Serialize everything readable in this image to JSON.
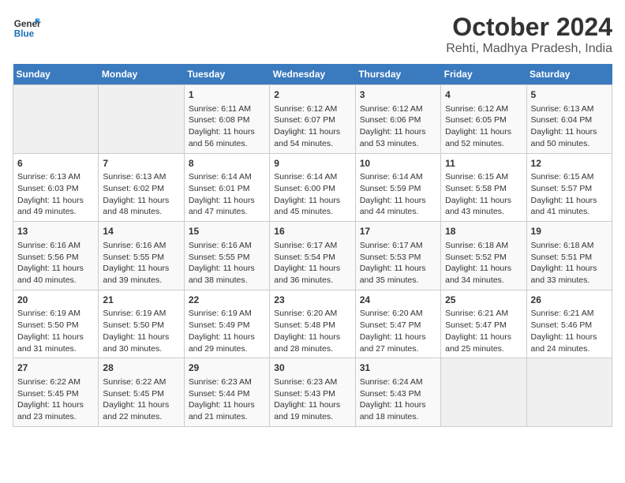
{
  "header": {
    "logo_line1": "General",
    "logo_line2": "Blue",
    "title": "October 2024",
    "subtitle": "Rehti, Madhya Pradesh, India"
  },
  "days_of_week": [
    "Sunday",
    "Monday",
    "Tuesday",
    "Wednesday",
    "Thursday",
    "Friday",
    "Saturday"
  ],
  "weeks": [
    [
      {
        "day": "",
        "content": ""
      },
      {
        "day": "",
        "content": ""
      },
      {
        "day": "1",
        "content": "Sunrise: 6:11 AM\nSunset: 6:08 PM\nDaylight: 11 hours and 56 minutes."
      },
      {
        "day": "2",
        "content": "Sunrise: 6:12 AM\nSunset: 6:07 PM\nDaylight: 11 hours and 54 minutes."
      },
      {
        "day": "3",
        "content": "Sunrise: 6:12 AM\nSunset: 6:06 PM\nDaylight: 11 hours and 53 minutes."
      },
      {
        "day": "4",
        "content": "Sunrise: 6:12 AM\nSunset: 6:05 PM\nDaylight: 11 hours and 52 minutes."
      },
      {
        "day": "5",
        "content": "Sunrise: 6:13 AM\nSunset: 6:04 PM\nDaylight: 11 hours and 50 minutes."
      }
    ],
    [
      {
        "day": "6",
        "content": "Sunrise: 6:13 AM\nSunset: 6:03 PM\nDaylight: 11 hours and 49 minutes."
      },
      {
        "day": "7",
        "content": "Sunrise: 6:13 AM\nSunset: 6:02 PM\nDaylight: 11 hours and 48 minutes."
      },
      {
        "day": "8",
        "content": "Sunrise: 6:14 AM\nSunset: 6:01 PM\nDaylight: 11 hours and 47 minutes."
      },
      {
        "day": "9",
        "content": "Sunrise: 6:14 AM\nSunset: 6:00 PM\nDaylight: 11 hours and 45 minutes."
      },
      {
        "day": "10",
        "content": "Sunrise: 6:14 AM\nSunset: 5:59 PM\nDaylight: 11 hours and 44 minutes."
      },
      {
        "day": "11",
        "content": "Sunrise: 6:15 AM\nSunset: 5:58 PM\nDaylight: 11 hours and 43 minutes."
      },
      {
        "day": "12",
        "content": "Sunrise: 6:15 AM\nSunset: 5:57 PM\nDaylight: 11 hours and 41 minutes."
      }
    ],
    [
      {
        "day": "13",
        "content": "Sunrise: 6:16 AM\nSunset: 5:56 PM\nDaylight: 11 hours and 40 minutes."
      },
      {
        "day": "14",
        "content": "Sunrise: 6:16 AM\nSunset: 5:55 PM\nDaylight: 11 hours and 39 minutes."
      },
      {
        "day": "15",
        "content": "Sunrise: 6:16 AM\nSunset: 5:55 PM\nDaylight: 11 hours and 38 minutes."
      },
      {
        "day": "16",
        "content": "Sunrise: 6:17 AM\nSunset: 5:54 PM\nDaylight: 11 hours and 36 minutes."
      },
      {
        "day": "17",
        "content": "Sunrise: 6:17 AM\nSunset: 5:53 PM\nDaylight: 11 hours and 35 minutes."
      },
      {
        "day": "18",
        "content": "Sunrise: 6:18 AM\nSunset: 5:52 PM\nDaylight: 11 hours and 34 minutes."
      },
      {
        "day": "19",
        "content": "Sunrise: 6:18 AM\nSunset: 5:51 PM\nDaylight: 11 hours and 33 minutes."
      }
    ],
    [
      {
        "day": "20",
        "content": "Sunrise: 6:19 AM\nSunset: 5:50 PM\nDaylight: 11 hours and 31 minutes."
      },
      {
        "day": "21",
        "content": "Sunrise: 6:19 AM\nSunset: 5:50 PM\nDaylight: 11 hours and 30 minutes."
      },
      {
        "day": "22",
        "content": "Sunrise: 6:19 AM\nSunset: 5:49 PM\nDaylight: 11 hours and 29 minutes."
      },
      {
        "day": "23",
        "content": "Sunrise: 6:20 AM\nSunset: 5:48 PM\nDaylight: 11 hours and 28 minutes."
      },
      {
        "day": "24",
        "content": "Sunrise: 6:20 AM\nSunset: 5:47 PM\nDaylight: 11 hours and 27 minutes."
      },
      {
        "day": "25",
        "content": "Sunrise: 6:21 AM\nSunset: 5:47 PM\nDaylight: 11 hours and 25 minutes."
      },
      {
        "day": "26",
        "content": "Sunrise: 6:21 AM\nSunset: 5:46 PM\nDaylight: 11 hours and 24 minutes."
      }
    ],
    [
      {
        "day": "27",
        "content": "Sunrise: 6:22 AM\nSunset: 5:45 PM\nDaylight: 11 hours and 23 minutes."
      },
      {
        "day": "28",
        "content": "Sunrise: 6:22 AM\nSunset: 5:45 PM\nDaylight: 11 hours and 22 minutes."
      },
      {
        "day": "29",
        "content": "Sunrise: 6:23 AM\nSunset: 5:44 PM\nDaylight: 11 hours and 21 minutes."
      },
      {
        "day": "30",
        "content": "Sunrise: 6:23 AM\nSunset: 5:43 PM\nDaylight: 11 hours and 19 minutes."
      },
      {
        "day": "31",
        "content": "Sunrise: 6:24 AM\nSunset: 5:43 PM\nDaylight: 11 hours and 18 minutes."
      },
      {
        "day": "",
        "content": ""
      },
      {
        "day": "",
        "content": ""
      }
    ]
  ]
}
